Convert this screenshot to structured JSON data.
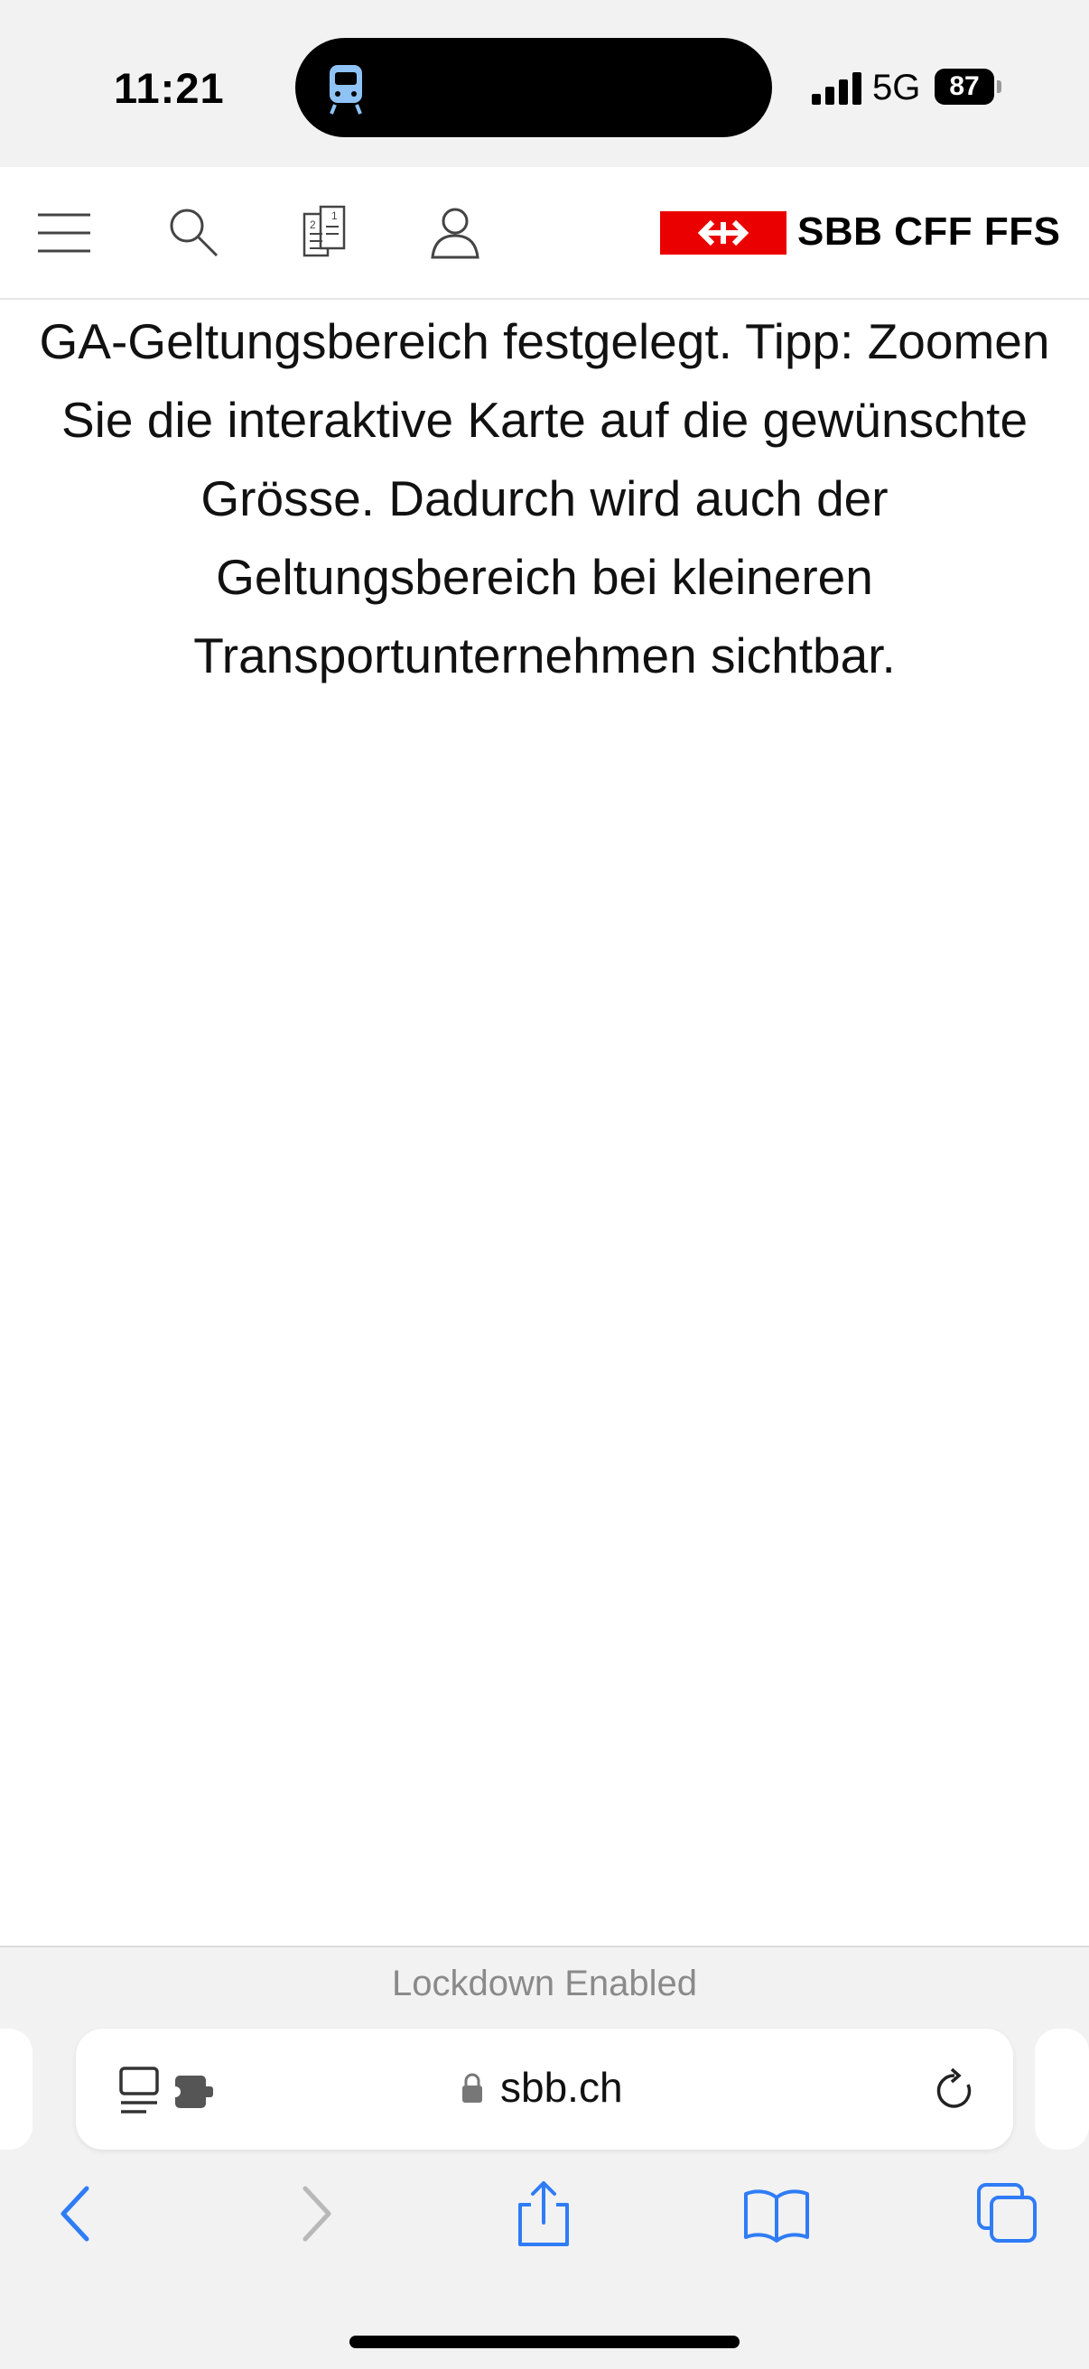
{
  "status_bar": {
    "time": "11:21",
    "network": "5G",
    "battery": "87",
    "live_activity_icon": "tram-icon"
  },
  "site_header": {
    "icons": [
      "menu-icon",
      "search-icon",
      "tickets-icon",
      "account-icon"
    ],
    "logo_text": "SBB CFF FFS",
    "brand_color": "#eb0000"
  },
  "content": {
    "text": "GA-Geltungsbereich festgelegt. Tipp: Zoomen Sie die interaktive Karte auf die gewünschte Grösse. Dadurch wird auch der Geltungsbereich bei kleineren Transportunternehmen sichtbar."
  },
  "safari": {
    "lockdown_label": "Lockdown Enabled",
    "url": "sbb.ch",
    "accent_color": "#2f7cf6",
    "toolbar": [
      "back-icon",
      "forward-icon",
      "share-icon",
      "bookmarks-icon",
      "tabs-icon"
    ]
  }
}
